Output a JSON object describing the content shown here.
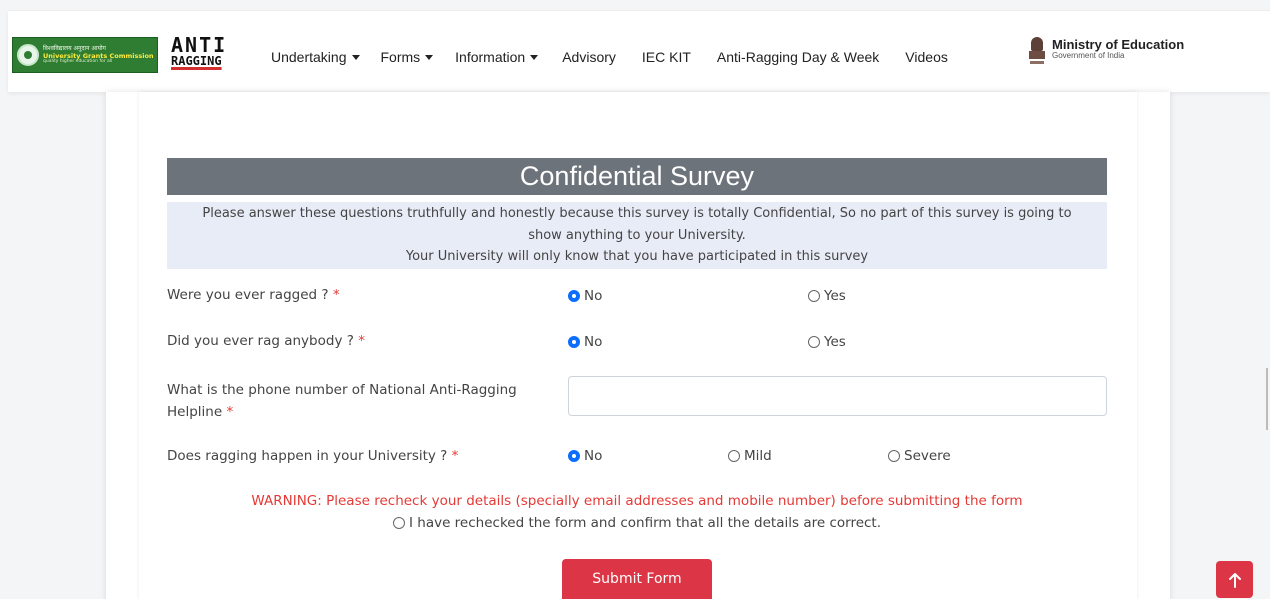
{
  "header": {
    "ugc_logo": {
      "line1": "विश्वविद्यालय अनुदान आयोग",
      "line2": "University Grants Commission",
      "line3": "quality higher education for all"
    },
    "anti_ragging_logo": {
      "line1": "ANTI",
      "line2": "RAGGING"
    },
    "nav": [
      {
        "label": "Undertaking",
        "dropdown": true
      },
      {
        "label": "Forms",
        "dropdown": true
      },
      {
        "label": "Information",
        "dropdown": true
      },
      {
        "label": "Advisory",
        "dropdown": false
      },
      {
        "label": "IEC KIT",
        "dropdown": false
      },
      {
        "label": "Anti-Ragging Day & Week",
        "dropdown": false
      },
      {
        "label": "Videos",
        "dropdown": false
      }
    ],
    "ministry": {
      "title": "Ministry of Education",
      "subtitle": "Government of India"
    }
  },
  "survey": {
    "title": "Confidential Survey",
    "notice_line1": "Please answer these questions truthfully and honestly because this survey is totally Confidential, So no part of this survey is going to",
    "notice_line2": "show anything to your University.",
    "notice_line3": "Your University will only know that you have participated in this survey",
    "required_marker": "*",
    "questions": [
      {
        "label": "Were you ever ragged ?",
        "options": [
          {
            "label": "No",
            "checked": true
          },
          {
            "label": "Yes",
            "checked": false
          }
        ]
      },
      {
        "label": "Did you ever rag anybody ?",
        "options": [
          {
            "label": "No",
            "checked": true
          },
          {
            "label": "Yes",
            "checked": false
          }
        ]
      },
      {
        "label_line1": "What is the phone number of National Anti-Ragging",
        "label_line2": "Helpline",
        "value": ""
      },
      {
        "label": "Does ragging happen in your University ?",
        "options": [
          {
            "label": "No",
            "checked": true
          },
          {
            "label": "Mild",
            "checked": false
          },
          {
            "label": "Severe",
            "checked": false
          }
        ]
      }
    ],
    "warning": "WARNING: Please recheck your details (specially email addresses and mobile number) before submitting the form",
    "confirm_label": "I have rechecked the form and confirm that all the details are correct.",
    "submit_label": "Submit Form"
  },
  "colors": {
    "title_bar": "#6c737a",
    "notice_bg": "#e8ecf7",
    "accent_red": "#dc3545",
    "radio_blue": "#0d6efd"
  }
}
